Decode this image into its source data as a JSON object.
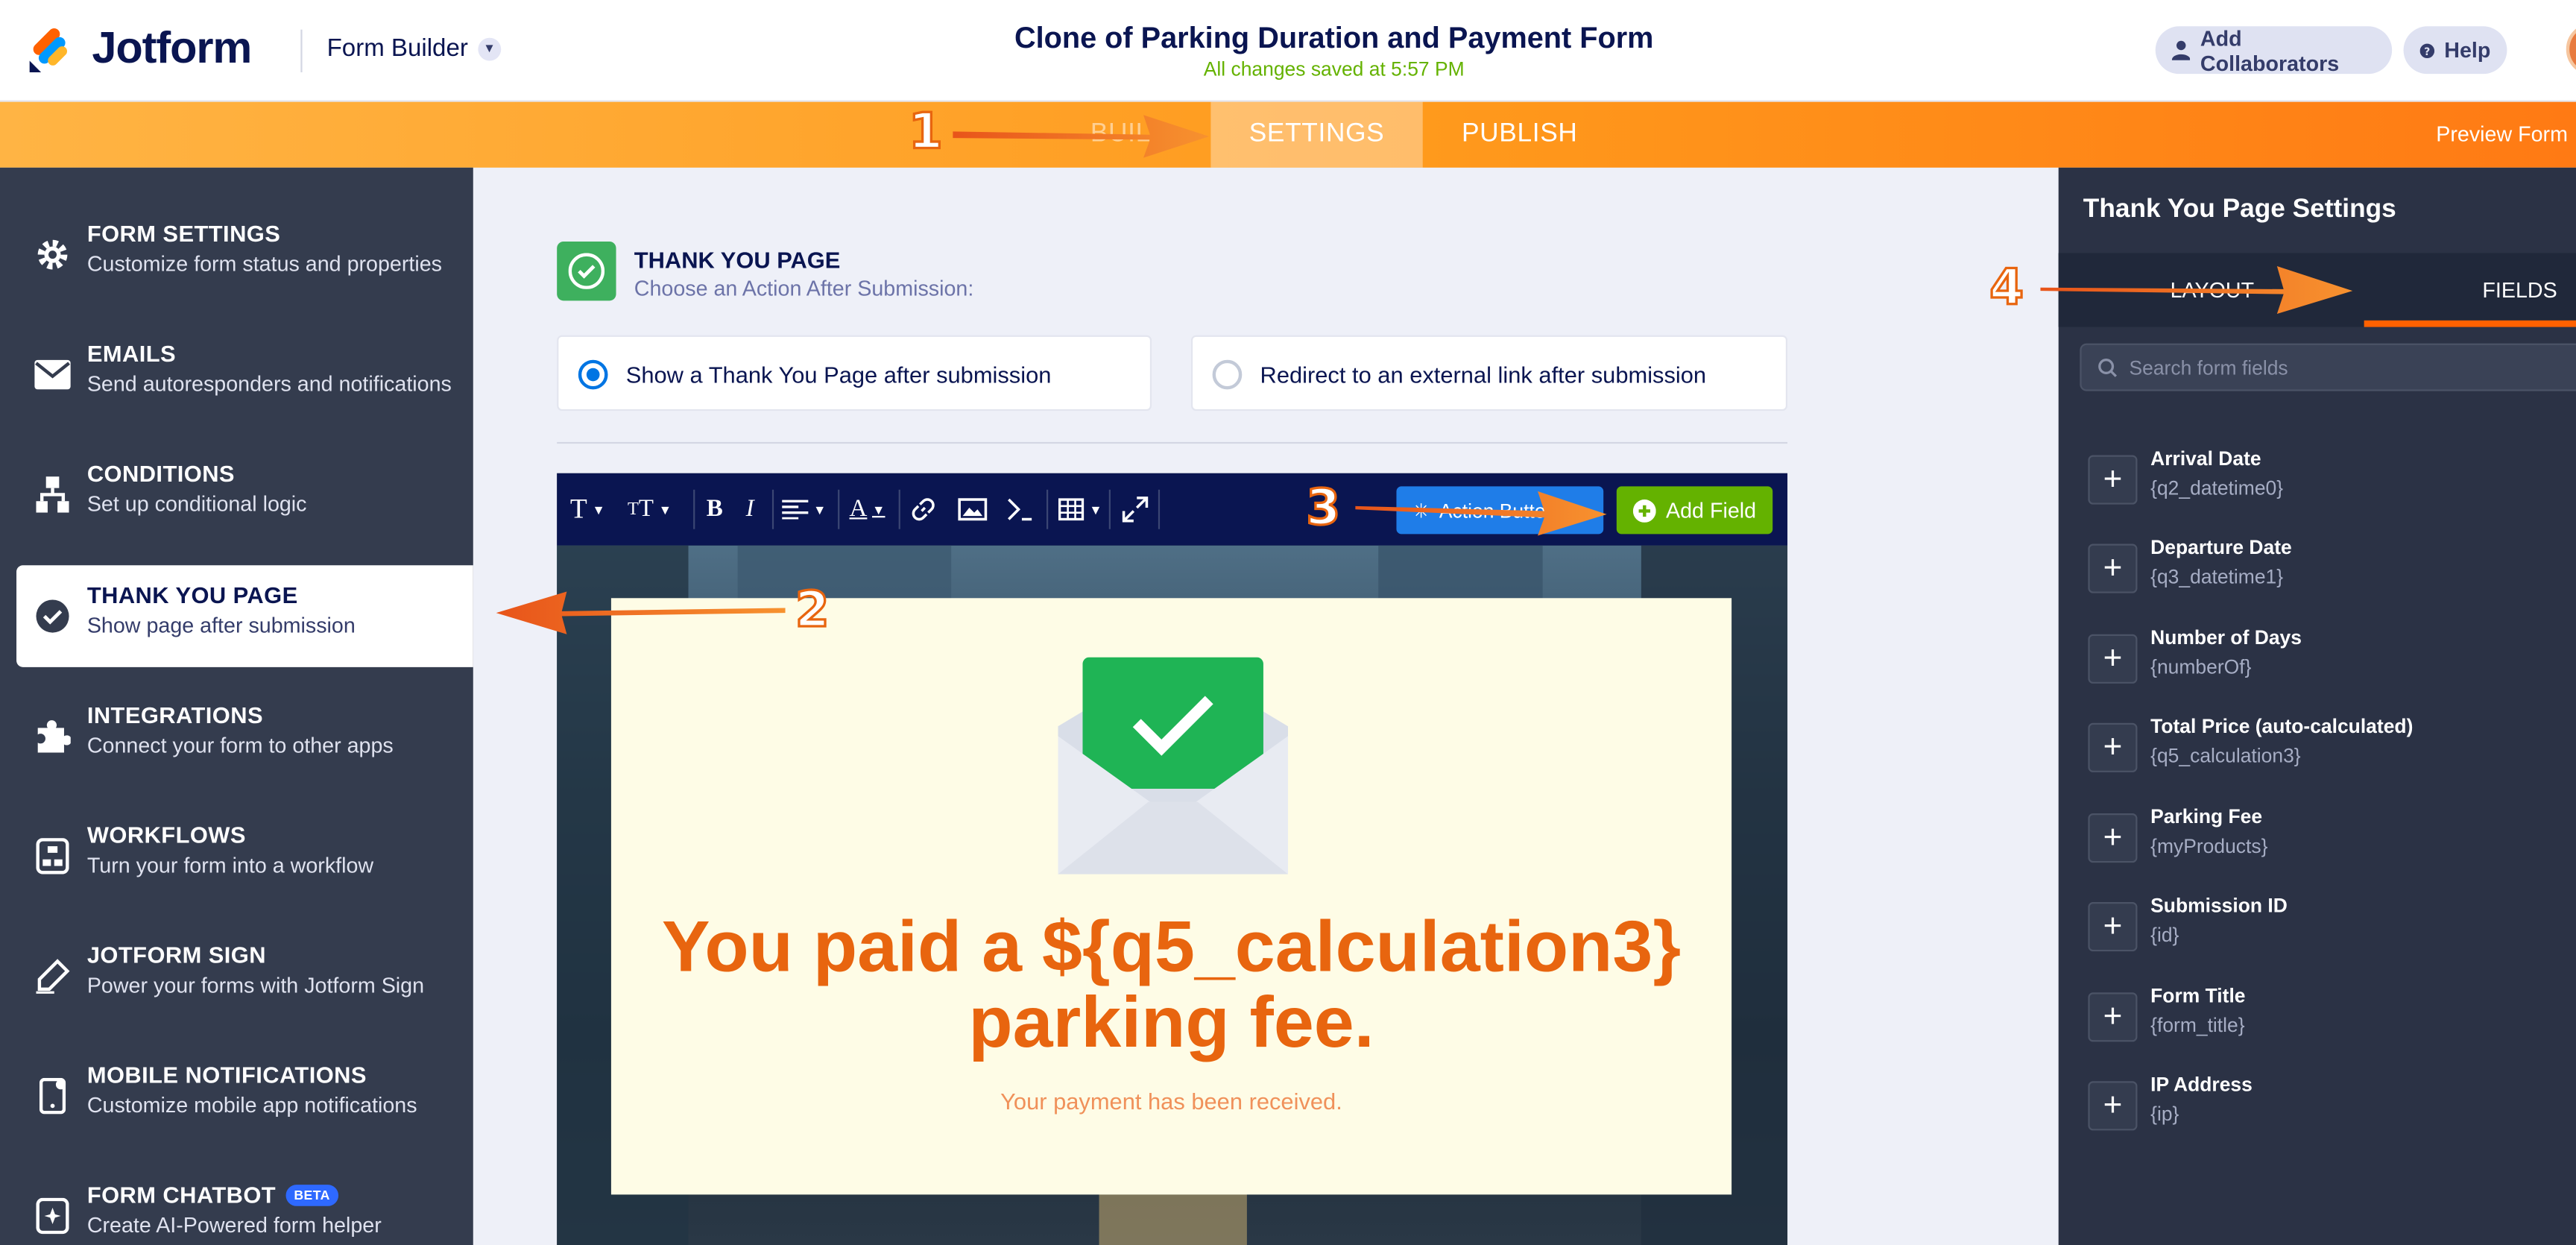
{
  "header": {
    "brand": "Jotform",
    "builder_label": "Form Builder",
    "form_title": "Clone of Parking Duration and Payment Form",
    "save_status": "All changes saved at 5:57 PM",
    "add_collaborators": "Add Collaborators",
    "help": "Help"
  },
  "nav": {
    "tabs": [
      {
        "label": "BUILD"
      },
      {
        "label": "SETTINGS"
      },
      {
        "label": "PUBLISH"
      }
    ],
    "preview": "Preview Form"
  },
  "sidebar": {
    "items": [
      {
        "title": "FORM SETTINGS",
        "subtitle": "Customize form status and properties",
        "icon": "gear-icon"
      },
      {
        "title": "EMAILS",
        "subtitle": "Send autoresponders and notifications",
        "icon": "envelope-icon"
      },
      {
        "title": "CONDITIONS",
        "subtitle": "Set up conditional logic",
        "icon": "hierarchy-icon"
      },
      {
        "title": "THANK YOU PAGE",
        "subtitle": "Show page after submission",
        "icon": "check-circle-icon"
      },
      {
        "title": "INTEGRATIONS",
        "subtitle": "Connect your form to other apps",
        "icon": "puzzle-icon"
      },
      {
        "title": "WORKFLOWS",
        "subtitle": "Turn your form into a workflow",
        "icon": "workflow-icon"
      },
      {
        "title": "JOTFORM SIGN",
        "subtitle": "Power your forms with Jotform Sign",
        "icon": "pen-icon"
      },
      {
        "title": "MOBILE NOTIFICATIONS",
        "subtitle": "Customize mobile app notifications",
        "icon": "mobile-icon"
      },
      {
        "title": "FORM CHATBOT",
        "subtitle": "Create AI-Powered form helper",
        "icon": "chatbot-icon",
        "badge": "BETA"
      }
    ]
  },
  "main": {
    "section_title": "THANK YOU PAGE",
    "section_subtitle": "Choose an Action After Submission:",
    "option_thankyou": "Show a Thank You Page after submission",
    "option_redirect": "Redirect to an external link after submission",
    "toolbar": {
      "action_button": "Action Button",
      "add_field": "Add Field"
    },
    "content": {
      "headline": "You paid a ${q5_calculation3} parking fee.",
      "subtext": "Your payment has been received."
    }
  },
  "right_panel": {
    "title": "Thank You Page Settings",
    "tabs": [
      "LAYOUT",
      "FIELDS"
    ],
    "search_placeholder": "Search form fields",
    "fields": [
      {
        "name": "Arrival Date",
        "var": "{q2_datetime0}"
      },
      {
        "name": "Departure Date",
        "var": "{q3_datetime1}"
      },
      {
        "name": "Number of Days",
        "var": "{numberOf}"
      },
      {
        "name": "Total Price (auto-calculated)",
        "var": "{q5_calculation3}"
      },
      {
        "name": "Parking Fee",
        "var": "{myProducts}"
      },
      {
        "name": "Submission ID",
        "var": "{id}"
      },
      {
        "name": "Form Title",
        "var": "{form_title}"
      },
      {
        "name": "IP Address",
        "var": "{ip}"
      }
    ]
  },
  "annotations": [
    "1",
    "2",
    "3",
    "4"
  ],
  "colors": {
    "brand_orange": "#ff6100",
    "navy": "#0a1551",
    "sidebar_bg": "#343c4e",
    "success_green": "#64b200",
    "accent_blue": "#0075e3"
  }
}
